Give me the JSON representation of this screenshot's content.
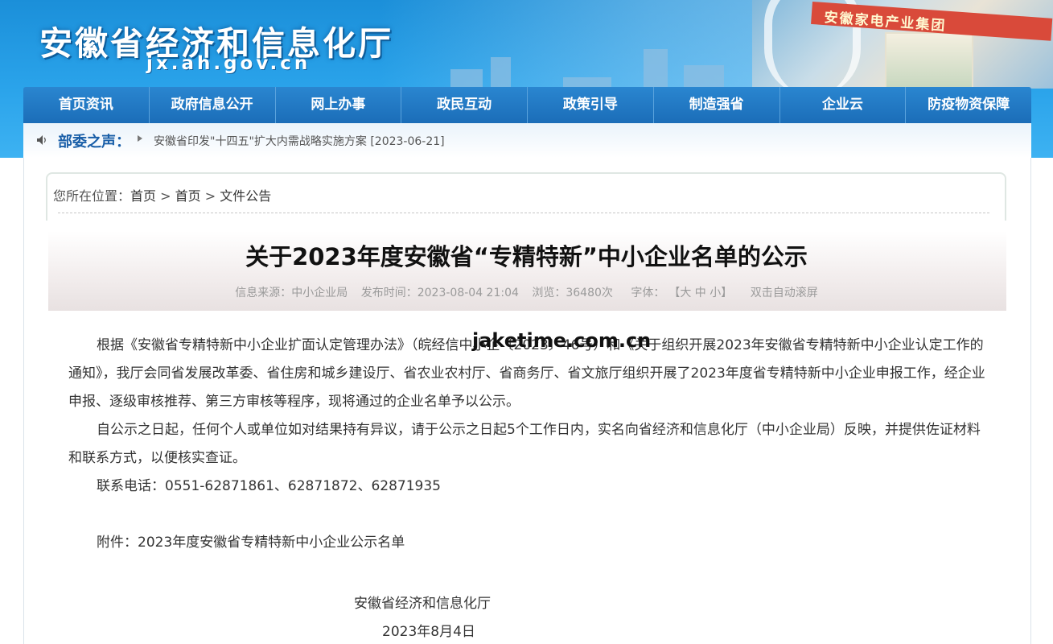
{
  "header": {
    "site_title": "安徽省经济和信息化厅",
    "site_domain": "jx.ah.gov.cn",
    "photo_sign": "安徽家电产业集团"
  },
  "nav": {
    "items": [
      "首页资讯",
      "政府信息公开",
      "网上办事",
      "政民互动",
      "政策引导",
      "制造强省",
      "企业云",
      "防疫物资保障"
    ]
  },
  "notice": {
    "label": "部委之声：",
    "item_text": "安徽省印发\"十四五\"扩大内需战略实施方案",
    "item_date": "[2023-06-21]"
  },
  "breadcrumb": {
    "prefix": "您所在位置：",
    "home1": "首页",
    "sep1": " > ",
    "home2": "首页",
    "sep2": " > ",
    "current": "文件公告"
  },
  "article": {
    "title": "关于2023年度安徽省“专精特新”中小企业名单的公示",
    "source": "信息来源：中小企业局",
    "publish_time": "发布时间：2023-08-04 21:04",
    "views": "浏览：36480次",
    "font_label": "字体：",
    "font_sizes": "【大 中 小】",
    "auto_scroll": "双击自动滚屏",
    "paragraphs": [
      "根据《安徽省专精特新中小企业扩面认定管理办法》（皖经信中小企〔2023〕46号）和《关于组织开展2023年安徽省专精特新中小企业认定工作的通知》，我厅会同省发展改革委、省住房和城乡建设厅、省农业农村厅、省商务厅、省文旅厅组织开展了2023年度省专精特新中小企业申报工作，经企业申报、逐级审核推荐、第三方审核等程序，现将通过的企业名单予以公示。",
      "自公示之日起，任何个人或单位如对结果持有异议，请于公示之日起5个工作日内，实名向省经济和信息化厅（中小企业局）反映，并提供佐证材料和联系方式，以便核实查证。",
      "联系电话：0551-62871861、62871872、62871935"
    ],
    "attachment": "附件：2023年度安徽省专精特新中小企业公示名单",
    "signer": "安徽省经济和信息化厅",
    "sign_date": "2023年8月4日"
  },
  "watermark": "jaketime.com.cn",
  "colors": {
    "header_blue": "#2aa3ea",
    "nav_blue": "#1b6db8",
    "notice_label": "#1a5fa8"
  }
}
